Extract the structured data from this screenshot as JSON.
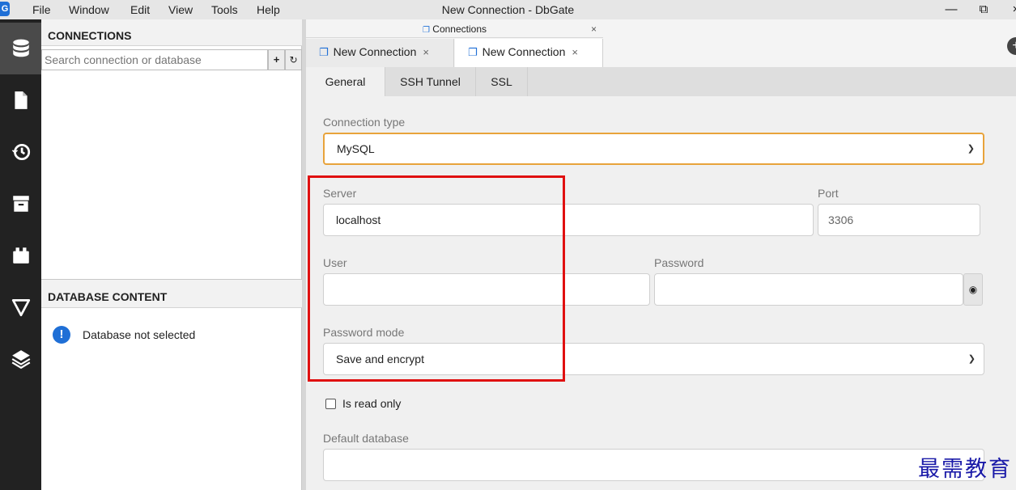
{
  "menu": {
    "items": [
      "File",
      "Window",
      "Edit",
      "View",
      "Tools",
      "Help"
    ],
    "window_title": "New Connection - DbGate",
    "controls": [
      "—",
      "⧉",
      "×"
    ]
  },
  "activitybar": {
    "icons": [
      "database-icon",
      "file-icon",
      "history-icon",
      "archive-icon",
      "plugin-icon",
      "filter-icon",
      "layers-icon"
    ]
  },
  "connections_panel": {
    "title": "CONNECTIONS",
    "search_placeholder": "Search connection or database",
    "add_label": "+",
    "refresh_label": "↻"
  },
  "database_panel": {
    "title": "DATABASE CONTENT",
    "info_icon": "!",
    "message": "Database not selected"
  },
  "tabs": {
    "group_title": "Connections",
    "group_close": "×",
    "documents": [
      {
        "label": "New Connection",
        "close": "×"
      },
      {
        "label": "New Connection",
        "close": "×"
      }
    ],
    "plug_glyph": "❐"
  },
  "subtabs": [
    "General",
    "SSH Tunnel",
    "SSL"
  ],
  "form": {
    "connection_type_label": "Connection type",
    "connection_type_value": "MySQL",
    "server_label": "Server",
    "server_value": "localhost",
    "port_label": "Port",
    "port_placeholder": "3306",
    "user_label": "User",
    "user_value": "",
    "password_label": "Password",
    "password_value": "",
    "password_mode_label": "Password mode",
    "password_mode_value": "Save and encrypt",
    "read_only_label": "Is read only",
    "read_only_checked": false,
    "default_database_label": "Default database",
    "default_database_value": ""
  },
  "watermark": "最需教育",
  "colors": {
    "accent": "#1f6fd6",
    "focus_border": "#e8a33b",
    "annotation": "#e01010",
    "activitybar": "#222222"
  }
}
